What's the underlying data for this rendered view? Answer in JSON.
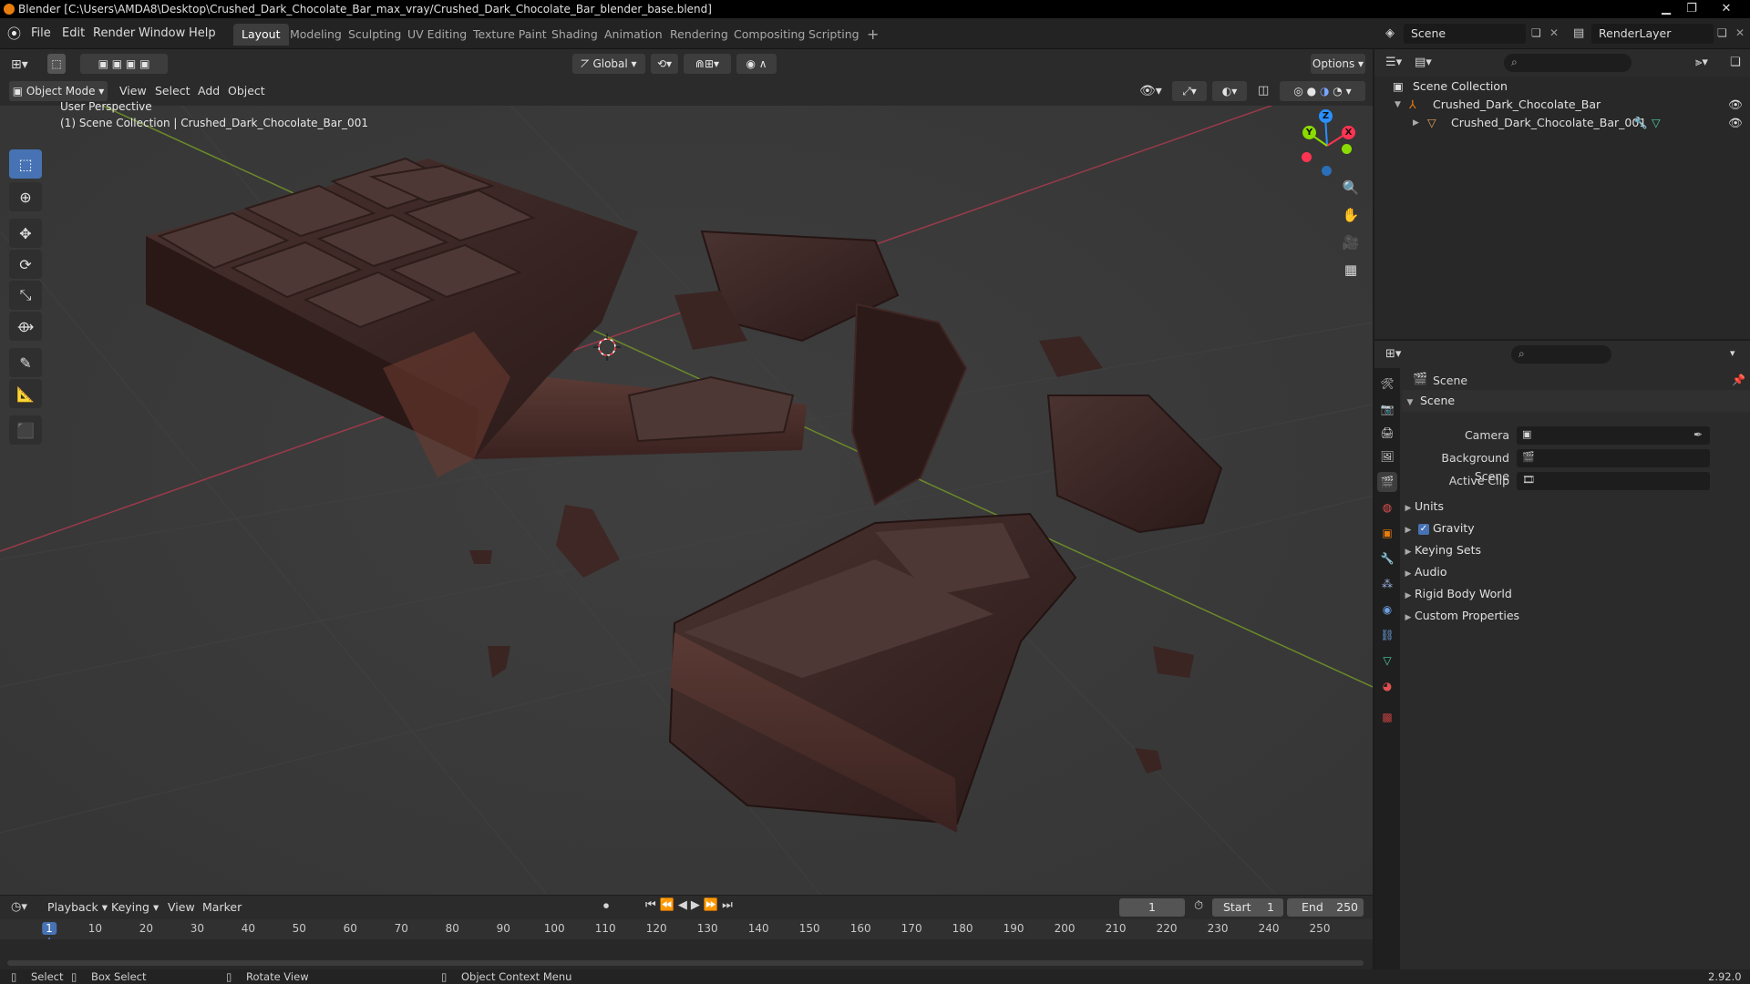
{
  "window": {
    "title": "Blender [C:\\Users\\AMDA8\\Desktop\\Crushed_Dark_Chocolate_Bar_max_vray/Crushed_Dark_Chocolate_Bar_blender_base.blend]",
    "minimize": "▁",
    "maximize": "❐",
    "close": "✕"
  },
  "menu": {
    "items": [
      "File",
      "Edit",
      "Render",
      "Window",
      "Help"
    ]
  },
  "workspaces": {
    "tabs": [
      "Layout",
      "Modeling",
      "Sculpting",
      "UV Editing",
      "Texture Paint",
      "Shading",
      "Animation",
      "Rendering",
      "Compositing",
      "Scripting"
    ],
    "add": "+",
    "active": "Layout"
  },
  "scene_selector": {
    "scene": "Scene",
    "view_layer": "RenderLayer"
  },
  "viewport": {
    "mode": "Object Mode",
    "menu": [
      "View",
      "Select",
      "Add",
      "Object"
    ],
    "transform_orientation": "Global",
    "options": "Options",
    "overlay_title": "User Perspective",
    "overlay_subtitle": "(1) Scene Collection | Crushed_Dark_Chocolate_Bar_001",
    "gizmo": {
      "x": "X",
      "y": "Y",
      "z": "Z"
    }
  },
  "outliner": {
    "root": "Scene Collection",
    "collection": "Crushed_Dark_Chocolate_Bar",
    "object": "Crushed_Dark_Chocolate_Bar_001"
  },
  "properties": {
    "context": "Scene",
    "panel": "Scene",
    "fields": [
      {
        "label": "Camera"
      },
      {
        "label": "Background Scene"
      },
      {
        "label": "Active Clip"
      }
    ],
    "subpanels": [
      "Units",
      "Gravity",
      "Keying Sets",
      "Audio",
      "Rigid Body World",
      "Custom Properties"
    ],
    "gravity_checked": true
  },
  "timeline": {
    "menu": [
      "Playback",
      "Keying",
      "View",
      "Marker"
    ],
    "current_frame": "1",
    "start_label": "Start",
    "start": "1",
    "end_label": "End",
    "end": "250",
    "ticks": [
      "1",
      "10",
      "20",
      "30",
      "40",
      "50",
      "60",
      "70",
      "80",
      "90",
      "100",
      "110",
      "120",
      "130",
      "140",
      "150",
      "160",
      "170",
      "180",
      "190",
      "200",
      "210",
      "220",
      "230",
      "240",
      "250"
    ]
  },
  "statusbar": {
    "select": "Select",
    "box_select": "Box Select",
    "rotate_view": "Rotate View",
    "context_menu": "Object Context Menu",
    "version": "2.92.0"
  },
  "colors": {
    "accent": "#4772b3",
    "axis_x": "#ff3352",
    "axis_y": "#8bdc00",
    "axis_z": "#2890ff",
    "chocolate": "#3a2422"
  }
}
